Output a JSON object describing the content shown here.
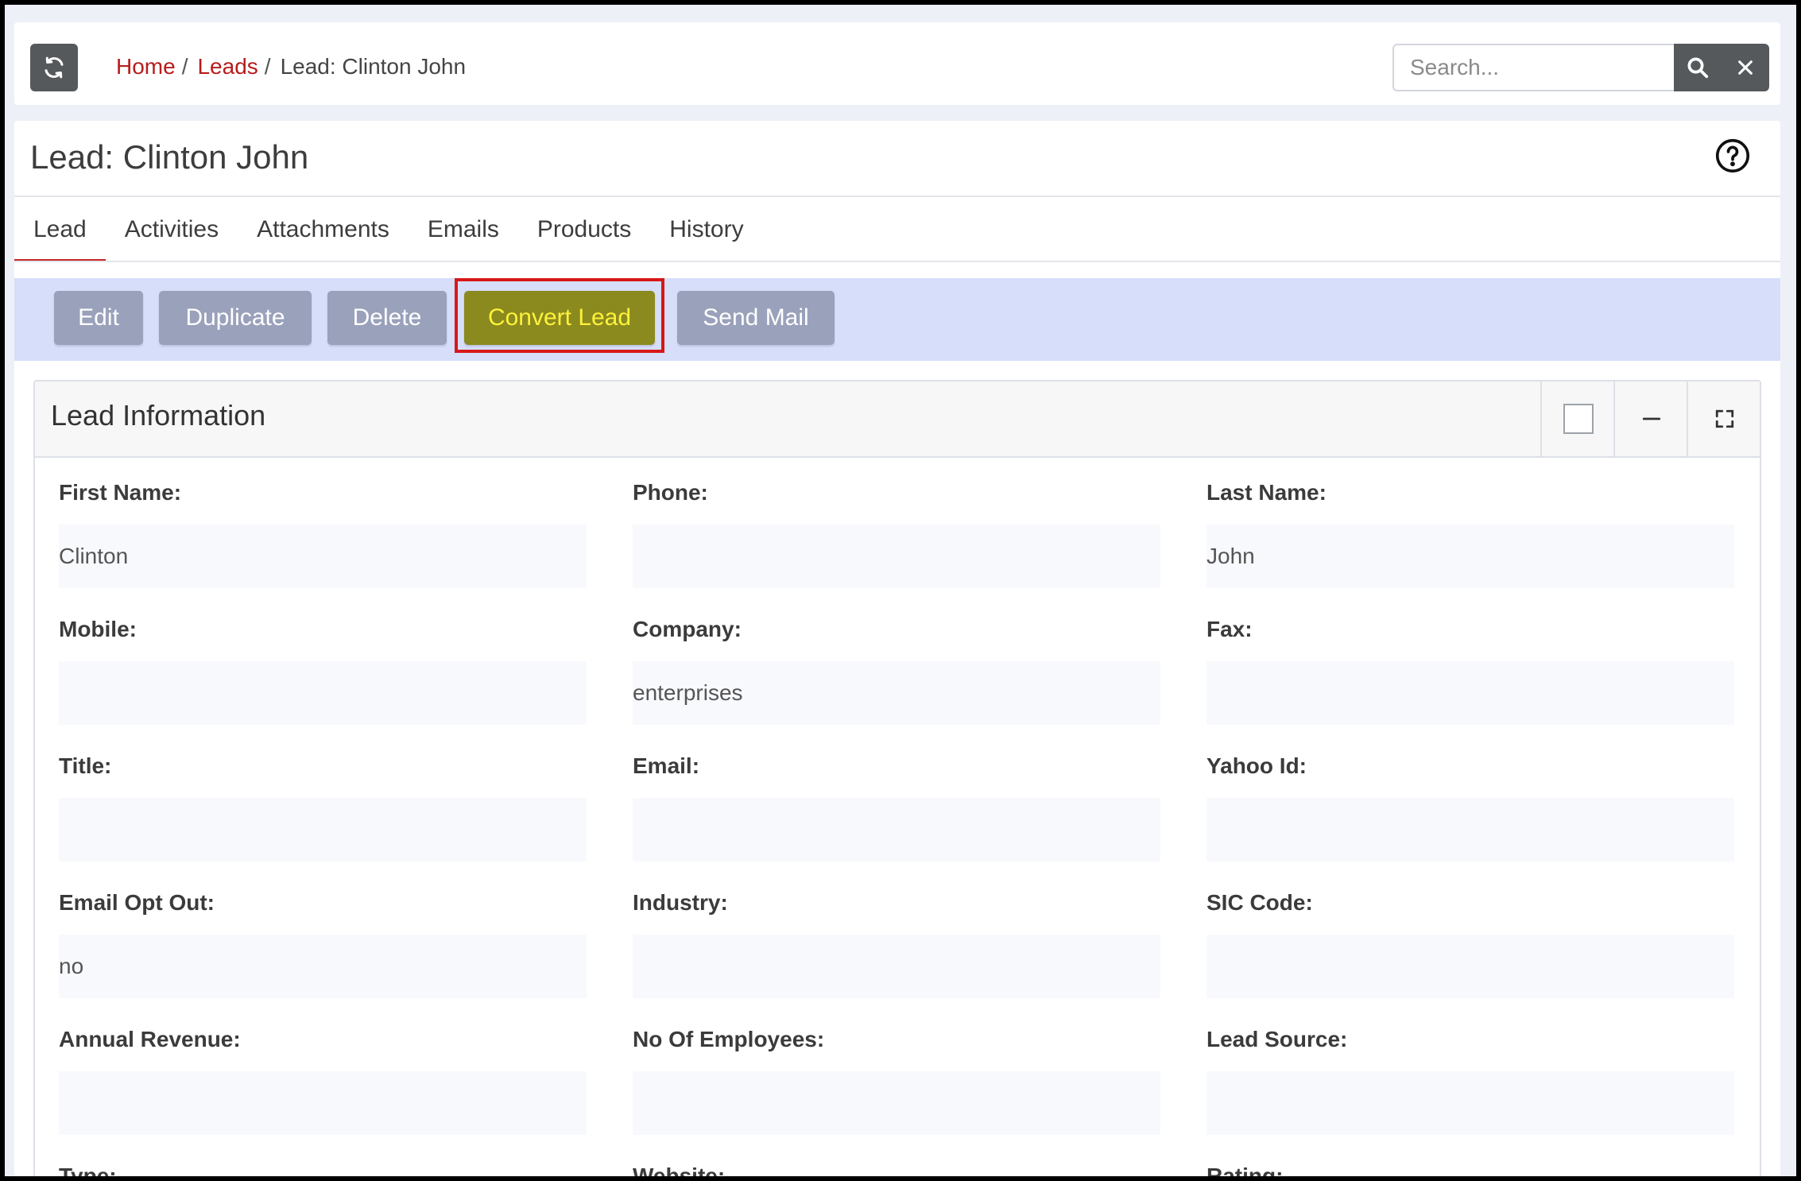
{
  "breadcrumb": {
    "home": "Home",
    "leads": "Leads",
    "current": "Lead: Clinton John",
    "separator": "/"
  },
  "search": {
    "placeholder": "Search..."
  },
  "page_title": "Lead: Clinton John",
  "tabs": [
    "Lead",
    "Activities",
    "Attachments",
    "Emails",
    "Products",
    "History"
  ],
  "actions": {
    "edit": "Edit",
    "duplicate": "Duplicate",
    "delete": "Delete",
    "convert": "Convert Lead",
    "send_mail": "Send Mail"
  },
  "card": {
    "title": "Lead Information"
  },
  "fields": {
    "first_name": {
      "label": "First Name:",
      "value": "Clinton"
    },
    "phone": {
      "label": "Phone:",
      "value": ""
    },
    "last_name": {
      "label": "Last Name:",
      "value": "John"
    },
    "mobile": {
      "label": "Mobile:",
      "value": ""
    },
    "company": {
      "label": "Company:",
      "value": "enterprises"
    },
    "fax": {
      "label": "Fax:",
      "value": ""
    },
    "title": {
      "label": "Title:",
      "value": ""
    },
    "email": {
      "label": "Email:",
      "value": ""
    },
    "yahoo_id": {
      "label": "Yahoo Id:",
      "value": ""
    },
    "email_opt_out": {
      "label": "Email Opt Out:",
      "value": "no"
    },
    "industry": {
      "label": "Industry:",
      "value": ""
    },
    "sic_code": {
      "label": "SIC Code:",
      "value": ""
    },
    "annual_revenue": {
      "label": "Annual Revenue:",
      "value": ""
    },
    "no_of_employees": {
      "label": "No Of Employees:",
      "value": ""
    },
    "lead_source": {
      "label": "Lead Source:",
      "value": ""
    },
    "type": {
      "label": "Type:",
      "value": ""
    },
    "website": {
      "label": "Website:",
      "value": ""
    },
    "rating": {
      "label": "Rating:",
      "value": ""
    }
  },
  "colors": {
    "accent_link": "#b71c1c",
    "action_bar": "#d6defa",
    "button": "#9aa1bb",
    "highlight_button": "#8b8a1f",
    "highlight_text": "#fff23a",
    "highlight_border": "#d61818"
  },
  "icons": [
    "refresh-icon",
    "search-icon",
    "close-icon",
    "help-icon",
    "checkbox-icon",
    "minimize-icon",
    "fullscreen-icon"
  ]
}
